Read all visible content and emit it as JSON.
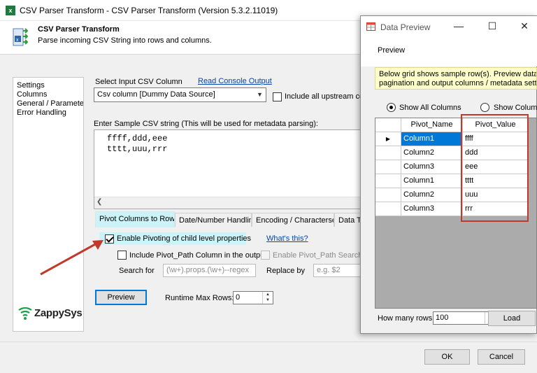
{
  "window": {
    "title": "CSV Parser Transform - CSV Parser Transform (Version 5.3.2.11019)",
    "app_icon_text": "x"
  },
  "header": {
    "title": "CSV Parser Transform",
    "description": "Parse incoming CSV String into rows and columns."
  },
  "sidebar": {
    "items": [
      "Settings",
      "Columns",
      "General / Parameters",
      "Error Handling"
    ],
    "logo_text": "ZappySys"
  },
  "settings": {
    "select_column_label": "Select Input CSV Column",
    "read_console_link": "Read Console Output",
    "column_value": "Csv column [Dummy Data Source]",
    "include_upstream_label": "Include all upstream colu",
    "sample_label": "Enter Sample CSV string (This will be used for metadata parsing):",
    "csv_lines": [
      "ffff,ddd,eee",
      "tttt,uuu,rrr"
    ]
  },
  "tabs": [
    "Pivot Columns to Rows",
    "Date/Number Handling",
    "Encoding / Characterset",
    "Data Ty"
  ],
  "pivot": {
    "enable_label": "Enable Pivoting of child level properties",
    "whats_this": "What's this?",
    "include_path_label": "Include Pivot_Path Column in the output",
    "enable_search_label": "Enable Pivot_Path Search/Re",
    "search_for_label": "Search for",
    "search_for_placeholder": "(\\w+).props.(\\w+)--regex",
    "replace_by_label": "Replace by",
    "replace_by_placeholder": "e.g. $2"
  },
  "actions": {
    "preview_button": "Preview",
    "runtime_max_rows_label": "Runtime Max Rows:",
    "runtime_max_rows_value": "0",
    "ok_button": "OK",
    "cancel_button": "Cancel"
  },
  "preview_dialog": {
    "title": "Data Preview",
    "heading": "Preview",
    "note_line1": "Below grid shows sample row(s). Preview data ignor",
    "note_line2": "pagination and output columns / metadata setting r",
    "radio_all": "Show All Columns",
    "radio_other": "Show Columns",
    "grid": {
      "headers": [
        "Pivot_Name",
        "Pivot_Value"
      ],
      "rows": [
        [
          "Column1",
          "ffff"
        ],
        [
          "Column2",
          "ddd"
        ],
        [
          "Column3",
          "eee"
        ],
        [
          "Column1",
          "tttt"
        ],
        [
          "Column2",
          "uuu"
        ],
        [
          "Column3",
          "rrr"
        ]
      ]
    },
    "how_many_rows_label": "How many rows",
    "how_many_rows_value": "100",
    "load_button": "Load"
  },
  "colors": {
    "highlight": "#ccf3f8",
    "selection": "#0078d7",
    "annotation_red": "#c0392b",
    "link": "#0645ad"
  }
}
